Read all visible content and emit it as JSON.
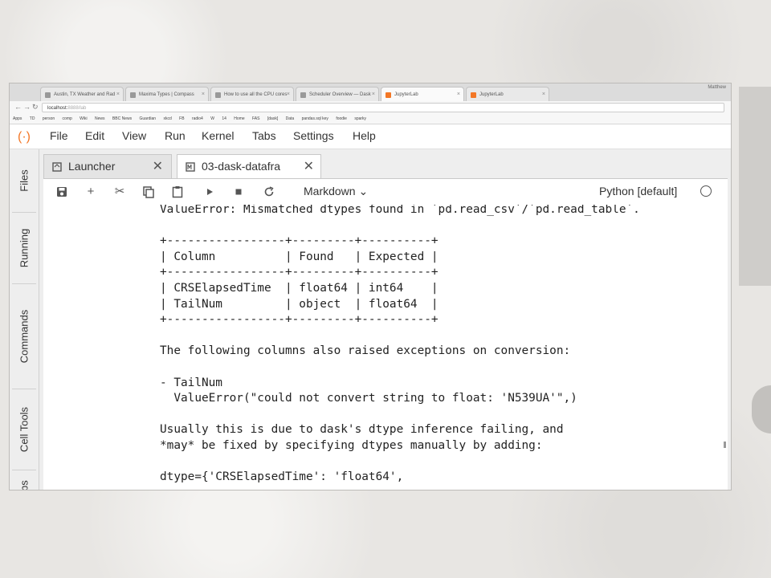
{
  "browser": {
    "tabs": [
      {
        "label": "Austin, TX Weather and Rad"
      },
      {
        "label": "Maxima Types | Compass"
      },
      {
        "label": "How to use all the CPU cores"
      },
      {
        "label": "Scheduler Overview — Dask"
      },
      {
        "label": "JupyterLab"
      },
      {
        "label": "JupyterLab"
      }
    ],
    "user": "Matthew",
    "url_host": "localhost:",
    "url_rest": "8888/lab",
    "bookmarks": [
      "Apps",
      "TD",
      "person",
      "comp",
      "Wiki",
      "News",
      "BBC News",
      "Guardian",
      "xkcd",
      "FB",
      "radio4",
      "W",
      "14",
      "Home",
      "FAS",
      "[dask]",
      "Data",
      "pandas.sql key",
      "foodie",
      "sparky"
    ]
  },
  "menu": [
    "File",
    "Edit",
    "View",
    "Run",
    "Kernel",
    "Tabs",
    "Settings",
    "Help"
  ],
  "sidebar": [
    "Files",
    "Running",
    "Commands",
    "Cell Tools",
    "Tabs"
  ],
  "doc_tabs": [
    {
      "label": "Launcher",
      "icon": "launcher-icon"
    },
    {
      "label": "03-dask-datafra",
      "icon": "notebook-icon"
    }
  ],
  "toolbar": {
    "cell_type": "Markdown",
    "kernel": "Python [default]"
  },
  "output_text": "ValueError: Mismatched dtypes found in `pd.read_csv`/`pd.read_table`.\n\n+-----------------+---------+----------+\n| Column          | Found   | Expected |\n+-----------------+---------+----------+\n| CRSElapsedTime  | float64 | int64    |\n| TailNum         | object  | float64  |\n+-----------------+---------+----------+\n\nThe following columns also raised exceptions on conversion:\n\n- TailNum\n  ValueError(\"could not convert string to float: 'N539UA'\",)\n\nUsually this is due to dask's dtype inference failing, and\n*may* be fixed by specifying dtypes manually by adding:\n\ndtype={'CRSElapsedTime': 'float64',"
}
